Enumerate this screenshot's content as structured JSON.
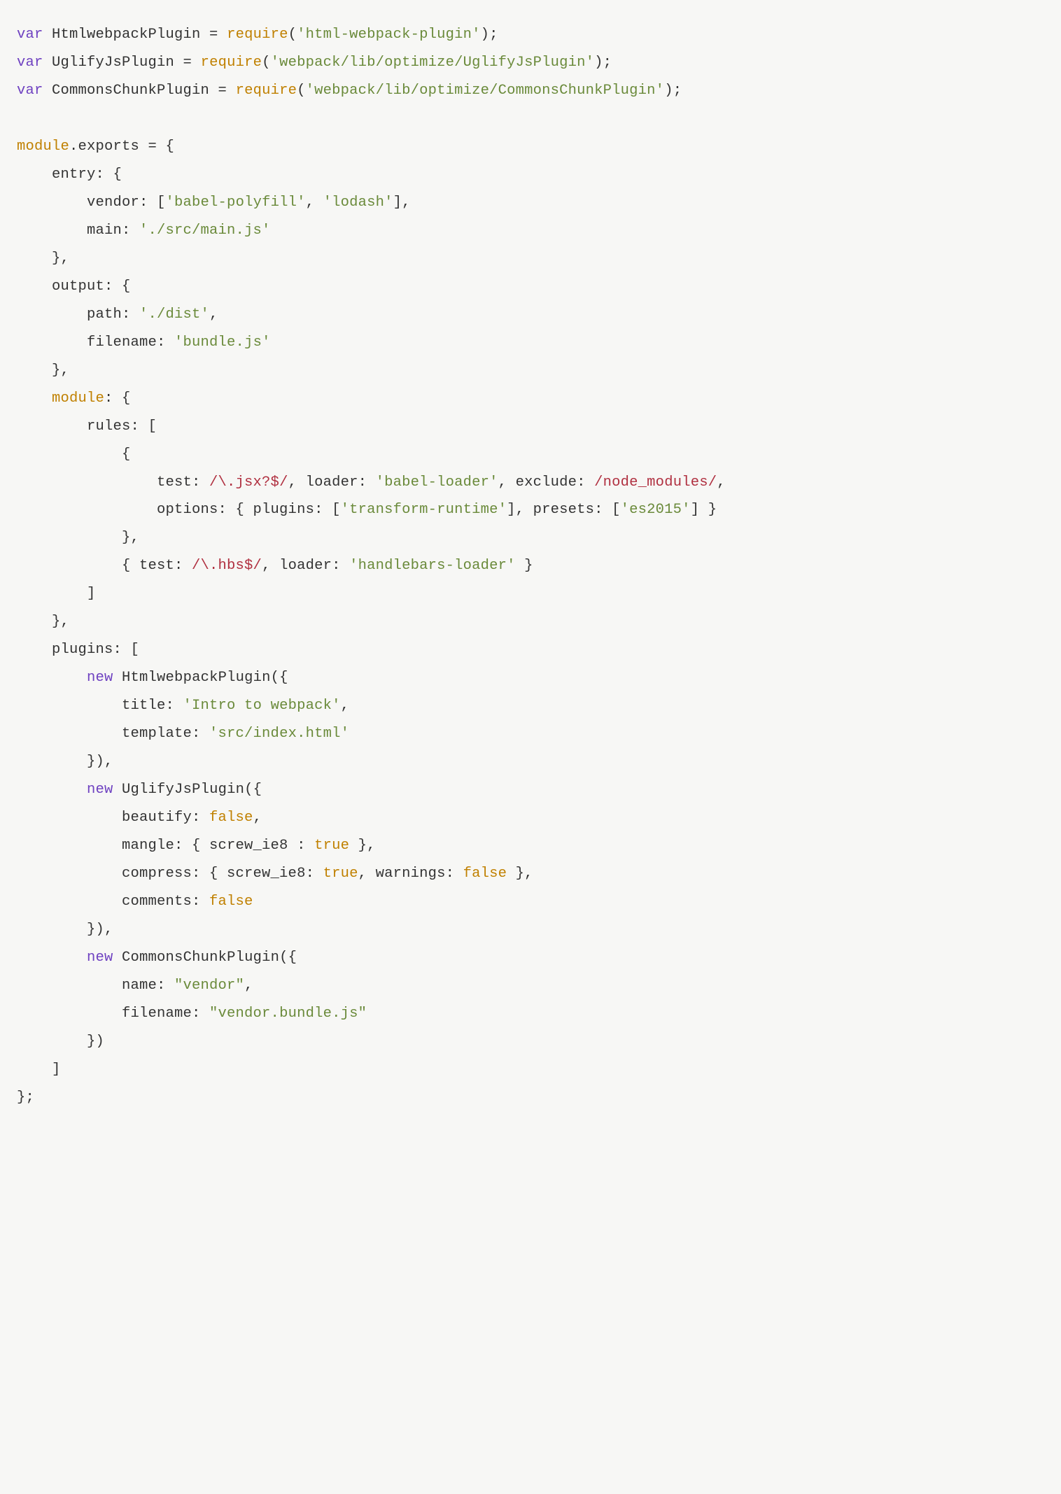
{
  "code": {
    "tokens": [
      {
        "t": "kw",
        "v": "var"
      },
      {
        "t": "id",
        "v": " HtmlwebpackPlugin = "
      },
      {
        "t": "fn",
        "v": "require"
      },
      {
        "t": "punc",
        "v": "("
      },
      {
        "t": "str",
        "v": "'html-webpack-plugin'"
      },
      {
        "t": "punc",
        "v": ");"
      },
      {
        "t": "nl"
      },
      {
        "t": "kw",
        "v": "var"
      },
      {
        "t": "id",
        "v": " UglifyJsPlugin = "
      },
      {
        "t": "fn",
        "v": "require"
      },
      {
        "t": "punc",
        "v": "("
      },
      {
        "t": "str",
        "v": "'webpack/lib/optimize/UglifyJsPlugin'"
      },
      {
        "t": "punc",
        "v": ");"
      },
      {
        "t": "nl"
      },
      {
        "t": "kw",
        "v": "var"
      },
      {
        "t": "id",
        "v": " CommonsChunkPlugin = "
      },
      {
        "t": "fn",
        "v": "require"
      },
      {
        "t": "punc",
        "v": "("
      },
      {
        "t": "str",
        "v": "'webpack/lib/optimize/CommonsChunkPlugin'"
      },
      {
        "t": "punc",
        "v": ");"
      },
      {
        "t": "nl"
      },
      {
        "t": "nl"
      },
      {
        "t": "mod",
        "v": "module"
      },
      {
        "t": "id",
        "v": ".exports = {"
      },
      {
        "t": "nl"
      },
      {
        "t": "id",
        "v": "    entry: {"
      },
      {
        "t": "nl"
      },
      {
        "t": "id",
        "v": "        vendor: ["
      },
      {
        "t": "str",
        "v": "'babel-polyfill'"
      },
      {
        "t": "id",
        "v": ", "
      },
      {
        "t": "str",
        "v": "'lodash'"
      },
      {
        "t": "id",
        "v": "],"
      },
      {
        "t": "nl"
      },
      {
        "t": "id",
        "v": "        main: "
      },
      {
        "t": "str",
        "v": "'./src/main.js'"
      },
      {
        "t": "nl"
      },
      {
        "t": "id",
        "v": "    },"
      },
      {
        "t": "nl"
      },
      {
        "t": "id",
        "v": "    output: {"
      },
      {
        "t": "nl"
      },
      {
        "t": "id",
        "v": "        path: "
      },
      {
        "t": "str",
        "v": "'./dist'"
      },
      {
        "t": "id",
        "v": ","
      },
      {
        "t": "nl"
      },
      {
        "t": "id",
        "v": "        filename: "
      },
      {
        "t": "str",
        "v": "'bundle.js'"
      },
      {
        "t": "nl"
      },
      {
        "t": "id",
        "v": "    },"
      },
      {
        "t": "nl"
      },
      {
        "t": "id",
        "v": "    "
      },
      {
        "t": "mod",
        "v": "module"
      },
      {
        "t": "id",
        "v": ": {"
      },
      {
        "t": "nl"
      },
      {
        "t": "id",
        "v": "        rules: ["
      },
      {
        "t": "nl"
      },
      {
        "t": "id",
        "v": "            {"
      },
      {
        "t": "nl"
      },
      {
        "t": "id",
        "v": "                test: "
      },
      {
        "t": "re",
        "v": "/\\.jsx?$/"
      },
      {
        "t": "id",
        "v": ", loader: "
      },
      {
        "t": "str",
        "v": "'babel-loader'"
      },
      {
        "t": "id",
        "v": ", exclude: "
      },
      {
        "t": "re",
        "v": "/node_modules/"
      },
      {
        "t": "id",
        "v": ","
      },
      {
        "t": "nl"
      },
      {
        "t": "id",
        "v": "                options: { plugins: ["
      },
      {
        "t": "str",
        "v": "'transform-runtime'"
      },
      {
        "t": "id",
        "v": "], presets: ["
      },
      {
        "t": "str",
        "v": "'es2015'"
      },
      {
        "t": "id",
        "v": "] }"
      },
      {
        "t": "nl"
      },
      {
        "t": "id",
        "v": "            },"
      },
      {
        "t": "nl"
      },
      {
        "t": "id",
        "v": "            { test: "
      },
      {
        "t": "re",
        "v": "/\\.hbs$/"
      },
      {
        "t": "id",
        "v": ", loader: "
      },
      {
        "t": "str",
        "v": "'handlebars-loader'"
      },
      {
        "t": "id",
        "v": " }"
      },
      {
        "t": "nl"
      },
      {
        "t": "id",
        "v": "        ]"
      },
      {
        "t": "nl"
      },
      {
        "t": "id",
        "v": "    },"
      },
      {
        "t": "nl"
      },
      {
        "t": "id",
        "v": "    plugins: ["
      },
      {
        "t": "nl"
      },
      {
        "t": "id",
        "v": "        "
      },
      {
        "t": "new",
        "v": "new"
      },
      {
        "t": "id",
        "v": " HtmlwebpackPlugin({"
      },
      {
        "t": "nl"
      },
      {
        "t": "id",
        "v": "            title: "
      },
      {
        "t": "str",
        "v": "'Intro to webpack'"
      },
      {
        "t": "id",
        "v": ","
      },
      {
        "t": "nl"
      },
      {
        "t": "id",
        "v": "            template: "
      },
      {
        "t": "str",
        "v": "'src/index.html'"
      },
      {
        "t": "nl"
      },
      {
        "t": "id",
        "v": "        }),"
      },
      {
        "t": "nl"
      },
      {
        "t": "id",
        "v": "        "
      },
      {
        "t": "new",
        "v": "new"
      },
      {
        "t": "id",
        "v": " UglifyJsPlugin({"
      },
      {
        "t": "nl"
      },
      {
        "t": "id",
        "v": "            beautify: "
      },
      {
        "t": "bool",
        "v": "false"
      },
      {
        "t": "id",
        "v": ","
      },
      {
        "t": "nl"
      },
      {
        "t": "id",
        "v": "            mangle: { screw_ie8 : "
      },
      {
        "t": "bool",
        "v": "true"
      },
      {
        "t": "id",
        "v": " },"
      },
      {
        "t": "nl"
      },
      {
        "t": "id",
        "v": "            compress: { screw_ie8: "
      },
      {
        "t": "bool",
        "v": "true"
      },
      {
        "t": "id",
        "v": ", warnings: "
      },
      {
        "t": "bool",
        "v": "false"
      },
      {
        "t": "id",
        "v": " },"
      },
      {
        "t": "nl"
      },
      {
        "t": "id",
        "v": "            comments: "
      },
      {
        "t": "bool",
        "v": "false"
      },
      {
        "t": "nl"
      },
      {
        "t": "id",
        "v": "        }),"
      },
      {
        "t": "nl"
      },
      {
        "t": "id",
        "v": "        "
      },
      {
        "t": "new",
        "v": "new"
      },
      {
        "t": "id",
        "v": " CommonsChunkPlugin({"
      },
      {
        "t": "nl"
      },
      {
        "t": "id",
        "v": "            name: "
      },
      {
        "t": "str",
        "v": "\"vendor\""
      },
      {
        "t": "id",
        "v": ","
      },
      {
        "t": "nl"
      },
      {
        "t": "id",
        "v": "            filename: "
      },
      {
        "t": "str",
        "v": "\"vendor.bundle.js\""
      },
      {
        "t": "nl"
      },
      {
        "t": "id",
        "v": "        })"
      },
      {
        "t": "nl"
      },
      {
        "t": "id",
        "v": "    ]"
      },
      {
        "t": "nl"
      },
      {
        "t": "id",
        "v": "};"
      }
    ]
  }
}
